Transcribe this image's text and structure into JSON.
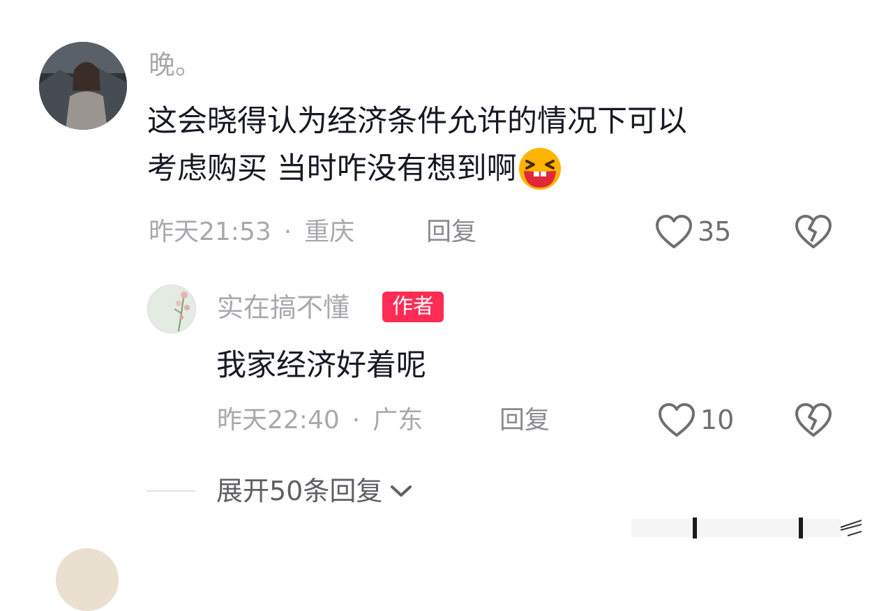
{
  "comment": {
    "username": "晚。",
    "text_line1": "这会晓得认为经济条件允许的情况下可以",
    "text_line2": "考虑购买 当时咋没有想到啊",
    "emoji": "laughing-emoji",
    "time": "昨天21:53",
    "separator": "·",
    "location": "重庆",
    "reply_label": "回复",
    "like_count": "35"
  },
  "reply": {
    "username": "实在搞不懂",
    "badge": "作者",
    "text": "我家经济好着呢",
    "time": "昨天22:40",
    "separator": "·",
    "location": "广东",
    "reply_label": "回复",
    "like_count": "10"
  },
  "expand": {
    "label": "展开50条回复"
  },
  "colors": {
    "accent": "#fe2c55",
    "muted_text": "#a8a8ad",
    "primary_text": "#161823"
  }
}
